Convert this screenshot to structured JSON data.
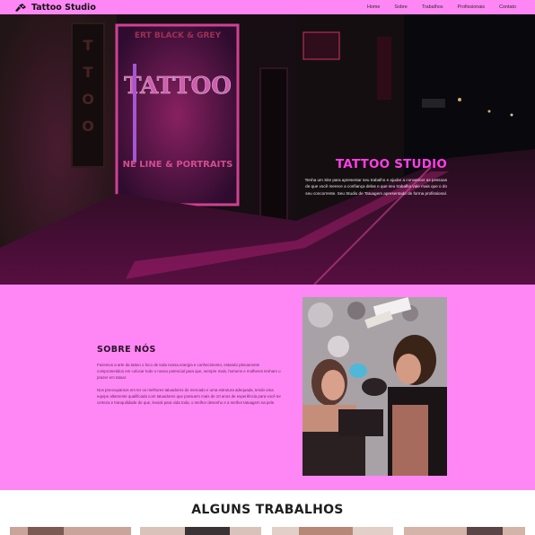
{
  "nav": {
    "brand": "Tattoo Studio",
    "brand_icon": "tattoo-machine-icon",
    "links": [
      "Home",
      "Sobre",
      "Trabalhos",
      "Profissionais",
      "Contato"
    ]
  },
  "hero": {
    "title": "TATTOO STUDIO",
    "description": "Tenha um Site para apresentar seu trabalho e ajudar a convencer as pessoas de que você merece a confiança delas e que seu trabalho vale mais que o do seu concorrente. Seu Studio de Tatuagem apresentado de forma profissional.",
    "sign_text": "TATTOO"
  },
  "about": {
    "title": "SOBRE NÓS",
    "paragraphs": [
      "Fazemos a arte da tattoo o foco de toda nossa energia e conhecimento, estando plenamente comprometidos em colocar todo o nosso potencial para que, sempre mais, homens e mulheres tenham o prazer em tatuar.",
      "Nos preocupamos em ter os melhores tatuadores do mercado e uma estrutura adequada, tendo uma equipe altamente qualificada com tatuadores que possuem mais de 10 anos de experiência para você ter certeza e tranquilidade de que, levará para vida toda, o melhor desenho e a melhor tatuagem na pele."
    ]
  },
  "works": {
    "title": "ALGUNS TRABALHOS"
  },
  "colors": {
    "accent_pink": "#ff87f5",
    "hero_title": "#ff3ee8",
    "dark_text": "#1e1e1e"
  }
}
